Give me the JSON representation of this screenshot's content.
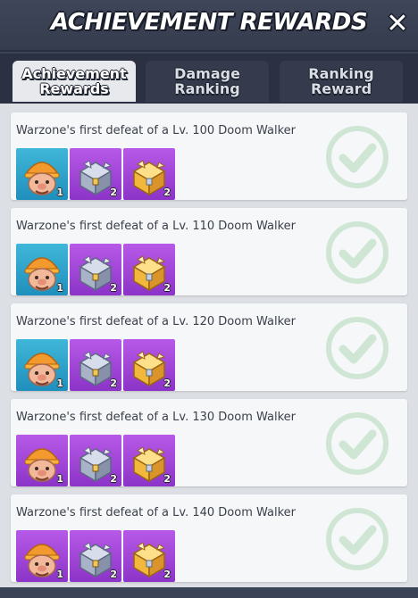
{
  "header": {
    "title": "ACHIEVEMENT REWARDS",
    "close_icon": "close-icon"
  },
  "tabs": [
    {
      "label": "Achievement\nRewards",
      "active": true
    },
    {
      "label": "Damage\nRanking",
      "active": false
    },
    {
      "label": "Ranking\nReward",
      "active": false
    }
  ],
  "rewards": [
    {
      "title": "Warzone's first defeat of a Lv. 100 Doom Walker",
      "items": [
        {
          "icon": "hero-portrait-icon",
          "count": "1",
          "rarity_color": "#2a9fcb"
        },
        {
          "icon": "silver-chest-icon",
          "count": "2",
          "rarity_color": "#a046d8"
        },
        {
          "icon": "gold-chest-icon",
          "count": "2",
          "rarity_color": "#a046d8"
        }
      ],
      "status_icon": "check-icon"
    },
    {
      "title": "Warzone's first defeat of a Lv. 110 Doom Walker",
      "items": [
        {
          "icon": "hero-portrait-icon",
          "count": "1",
          "rarity_color": "#2a9fcb"
        },
        {
          "icon": "silver-chest-icon",
          "count": "2",
          "rarity_color": "#a046d8"
        },
        {
          "icon": "gold-chest-icon",
          "count": "2",
          "rarity_color": "#a046d8"
        }
      ],
      "status_icon": "check-icon"
    },
    {
      "title": "Warzone's first defeat of a Lv. 120 Doom Walker",
      "items": [
        {
          "icon": "hero-portrait-icon",
          "count": "1",
          "rarity_color": "#2a9fcb"
        },
        {
          "icon": "silver-chest-icon",
          "count": "2",
          "rarity_color": "#a046d8"
        },
        {
          "icon": "gold-chest-icon",
          "count": "2",
          "rarity_color": "#a046d8"
        }
      ],
      "status_icon": "check-icon"
    },
    {
      "title": "Warzone's first defeat of a Lv. 130 Doom Walker",
      "items": [
        {
          "icon": "hero-portrait-icon",
          "count": "1",
          "rarity_color": "#a046d8"
        },
        {
          "icon": "silver-chest-icon",
          "count": "2",
          "rarity_color": "#a046d8"
        },
        {
          "icon": "gold-chest-icon",
          "count": "2",
          "rarity_color": "#a046d8"
        }
      ],
      "status_icon": "check-icon"
    },
    {
      "title": "Warzone's first defeat of a Lv. 140 Doom Walker",
      "items": [
        {
          "icon": "hero-portrait-icon",
          "count": "1",
          "rarity_color": "#a046d8"
        },
        {
          "icon": "silver-chest-icon",
          "count": "2",
          "rarity_color": "#a046d8"
        },
        {
          "icon": "gold-chest-icon",
          "count": "2",
          "rarity_color": "#a046d8"
        }
      ],
      "status_icon": "check-icon"
    }
  ],
  "colors": {
    "header_bg": "#3b4356",
    "content_bg": "#dcdfe4",
    "card_bg": "#f6f7f8",
    "check_color": "#cde3d3",
    "blue_rarity": "#2a9fcb",
    "purple_rarity": "#a046d8"
  }
}
